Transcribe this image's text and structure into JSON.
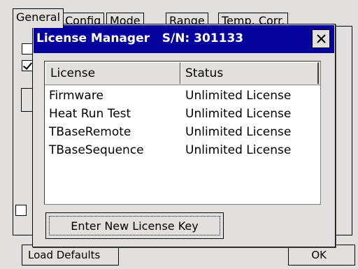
{
  "tabs": [
    {
      "label": "General",
      "active": true
    },
    {
      "label": "Config"
    },
    {
      "label": "Mode"
    },
    {
      "label": "Range"
    },
    {
      "label": "Temp. Corr."
    }
  ],
  "settings": {
    "checkbox_1": {
      "checked": false
    },
    "checkbox_2": {
      "checked": true
    },
    "checkbox_3": {
      "checked": false
    }
  },
  "footer": {
    "load_defaults_label": "Load Defaults",
    "ok_label": "OK"
  },
  "dialog": {
    "title": "License Manager   S/N: 301133",
    "close_icon": "close-icon",
    "columns": {
      "license": "License",
      "status": "Status"
    },
    "rows": [
      {
        "license": "Firmware",
        "status": "Unlimited License"
      },
      {
        "license": "Heat Run Test",
        "status": "Unlimited License"
      },
      {
        "license": "TBaseRemote",
        "status": "Unlimited License"
      },
      {
        "license": "TBaseSequence",
        "status": "Unlimited License"
      }
    ],
    "enter_key_label": "Enter New License Key"
  },
  "colors": {
    "titlebar": "#06049c",
    "face": "#e2e0de"
  }
}
